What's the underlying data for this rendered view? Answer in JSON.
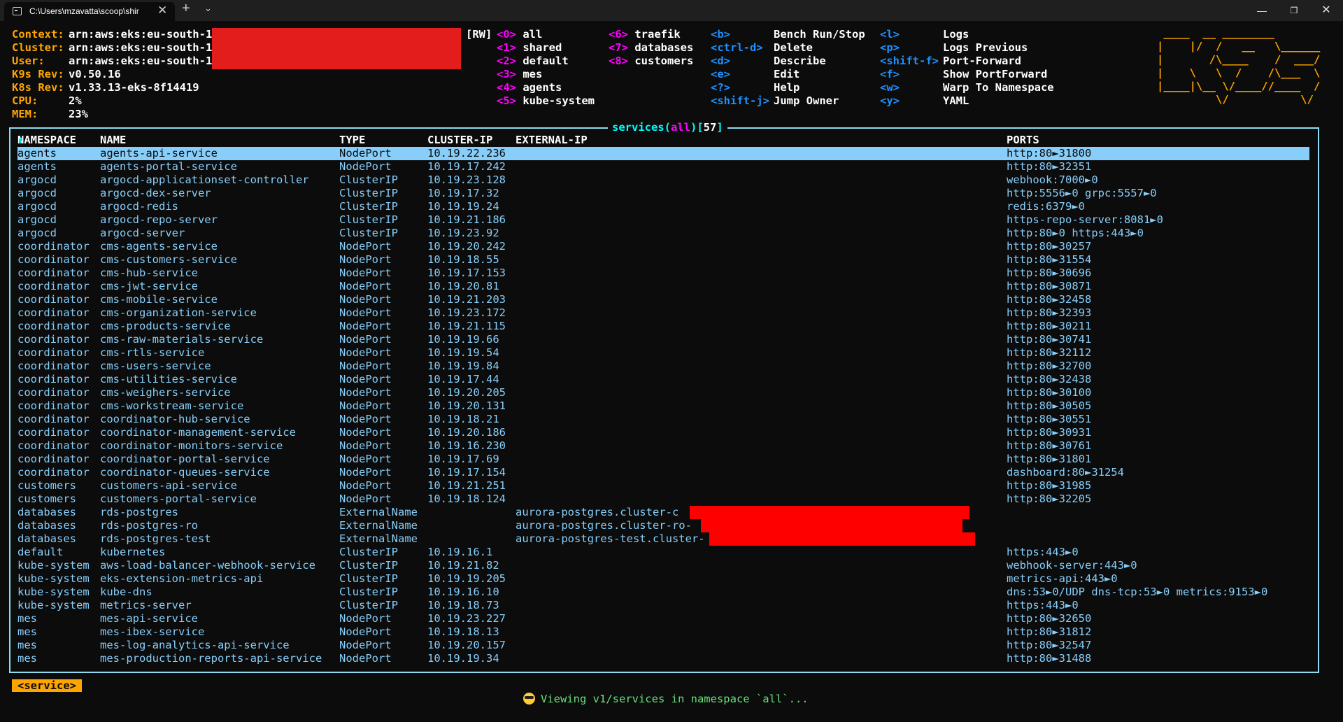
{
  "window": {
    "tab_title": "C:\\Users\\mzavatta\\scoop\\shir",
    "close_glyph": "✕",
    "new_tab_glyph": "+",
    "dropdown_glyph": "⌄",
    "minimize_glyph": "—",
    "maximize_glyph": "❐",
    "window_close_glyph": "✕"
  },
  "header": {
    "context_label": "Context:",
    "context_value": "arn:aws:eks:eu-south-1:",
    "cluster_label": "Cluster:",
    "cluster_value": "arn:aws:eks:eu-south-1:",
    "user_label": "User:",
    "user_value": "arn:aws:eks:eu-south-1:",
    "k9s_rev_label": "K9s Rev:",
    "k9s_rev_value": "v0.50.16",
    "k8s_rev_label": "K8s Rev:",
    "k8s_rev_value": "v1.33.13-eks-8f14419",
    "cpu_label": "CPU:",
    "cpu_value": "2%",
    "mem_label": "MEM:",
    "mem_value": "23%"
  },
  "namespaces": {
    "mode": "[RW]",
    "col1": [
      {
        "key": "<0>",
        "name": "all"
      },
      {
        "key": "<1>",
        "name": "shared"
      },
      {
        "key": "<2>",
        "name": "default"
      },
      {
        "key": "<3>",
        "name": "mes"
      },
      {
        "key": "<4>",
        "name": "agents"
      },
      {
        "key": "<5>",
        "name": "kube-system"
      }
    ],
    "col2": [
      {
        "key": "<6>",
        "name": "traefik"
      },
      {
        "key": "<7>",
        "name": "databases"
      },
      {
        "key": "<8>",
        "name": "customers"
      }
    ]
  },
  "shortcuts": {
    "col1": [
      {
        "key": "<b>",
        "desc": "Bench Run/Stop"
      },
      {
        "key": "<ctrl-d>",
        "desc": "Delete"
      },
      {
        "key": "<d>",
        "desc": "Describe"
      },
      {
        "key": "<e>",
        "desc": "Edit"
      },
      {
        "key": "<?>",
        "desc": "Help"
      },
      {
        "key": "<shift-j>",
        "desc": "Jump Owner"
      }
    ],
    "col2": [
      {
        "key": "<l>",
        "desc": "Logs"
      },
      {
        "key": "<p>",
        "desc": "Logs Previous"
      },
      {
        "key": "<shift-f>",
        "desc": "Port-Forward"
      },
      {
        "key": "<f>",
        "desc": "Show PortForward"
      },
      {
        "key": "<w>",
        "desc": "Warp To Namespace"
      },
      {
        "key": "<y>",
        "desc": "YAML"
      }
    ]
  },
  "logo_art": " ____  __ ________       \n|    |/  /   __   \\______\n|       /\\____    /  ___/\n|    \\   \\  /    /\\___  \\\n|____|\\__ \\/____//____  /\n         \\/           \\/ ",
  "table": {
    "title_resource": "services",
    "title_ns": "all",
    "title_count": "57",
    "headers": {
      "namespace": "NAMESPACE",
      "sort_arrow": "↑",
      "name": "NAME",
      "type": "TYPE",
      "cluster_ip": "CLUSTER-IP",
      "external_ip": "EXTERNAL-IP",
      "ports": "PORTS"
    },
    "rows": [
      {
        "ns": "agents",
        "name": "agents-api-service",
        "type": "NodePort",
        "ip": "10.19.22.236",
        "ext": "",
        "ports": "http:80►31800"
      },
      {
        "ns": "agents",
        "name": "agents-portal-service",
        "type": "NodePort",
        "ip": "10.19.17.242",
        "ext": "",
        "ports": "http:80►32351"
      },
      {
        "ns": "argocd",
        "name": "argocd-applicationset-controller",
        "type": "ClusterIP",
        "ip": "10.19.23.128",
        "ext": "",
        "ports": "webhook:7000►0"
      },
      {
        "ns": "argocd",
        "name": "argocd-dex-server",
        "type": "ClusterIP",
        "ip": "10.19.17.32",
        "ext": "",
        "ports": "http:5556►0 grpc:5557►0"
      },
      {
        "ns": "argocd",
        "name": "argocd-redis",
        "type": "ClusterIP",
        "ip": "10.19.19.24",
        "ext": "",
        "ports": "redis:6379►0"
      },
      {
        "ns": "argocd",
        "name": "argocd-repo-server",
        "type": "ClusterIP",
        "ip": "10.19.21.186",
        "ext": "",
        "ports": "https-repo-server:8081►0"
      },
      {
        "ns": "argocd",
        "name": "argocd-server",
        "type": "ClusterIP",
        "ip": "10.19.23.92",
        "ext": "",
        "ports": "http:80►0 https:443►0"
      },
      {
        "ns": "coordinator",
        "name": "cms-agents-service",
        "type": "NodePort",
        "ip": "10.19.20.242",
        "ext": "",
        "ports": "http:80►30257"
      },
      {
        "ns": "coordinator",
        "name": "cms-customers-service",
        "type": "NodePort",
        "ip": "10.19.18.55",
        "ext": "",
        "ports": "http:80►31554"
      },
      {
        "ns": "coordinator",
        "name": "cms-hub-service",
        "type": "NodePort",
        "ip": "10.19.17.153",
        "ext": "",
        "ports": "http:80►30696"
      },
      {
        "ns": "coordinator",
        "name": "cms-jwt-service",
        "type": "NodePort",
        "ip": "10.19.20.81",
        "ext": "",
        "ports": "http:80►30871"
      },
      {
        "ns": "coordinator",
        "name": "cms-mobile-service",
        "type": "NodePort",
        "ip": "10.19.21.203",
        "ext": "",
        "ports": "http:80►32458"
      },
      {
        "ns": "coordinator",
        "name": "cms-organization-service",
        "type": "NodePort",
        "ip": "10.19.23.172",
        "ext": "",
        "ports": "http:80►32393"
      },
      {
        "ns": "coordinator",
        "name": "cms-products-service",
        "type": "NodePort",
        "ip": "10.19.21.115",
        "ext": "",
        "ports": "http:80►30211"
      },
      {
        "ns": "coordinator",
        "name": "cms-raw-materials-service",
        "type": "NodePort",
        "ip": "10.19.19.66",
        "ext": "",
        "ports": "http:80►30741"
      },
      {
        "ns": "coordinator",
        "name": "cms-rtls-service",
        "type": "NodePort",
        "ip": "10.19.19.54",
        "ext": "",
        "ports": "http:80►32112"
      },
      {
        "ns": "coordinator",
        "name": "cms-users-service",
        "type": "NodePort",
        "ip": "10.19.19.84",
        "ext": "",
        "ports": "http:80►32700"
      },
      {
        "ns": "coordinator",
        "name": "cms-utilities-service",
        "type": "NodePort",
        "ip": "10.19.17.44",
        "ext": "",
        "ports": "http:80►32438"
      },
      {
        "ns": "coordinator",
        "name": "cms-weighers-service",
        "type": "NodePort",
        "ip": "10.19.20.205",
        "ext": "",
        "ports": "http:80►30100"
      },
      {
        "ns": "coordinator",
        "name": "cms-workstream-service",
        "type": "NodePort",
        "ip": "10.19.20.131",
        "ext": "",
        "ports": "http:80►30505"
      },
      {
        "ns": "coordinator",
        "name": "coordinator-hub-service",
        "type": "NodePort",
        "ip": "10.19.18.21",
        "ext": "",
        "ports": "http:80►30551"
      },
      {
        "ns": "coordinator",
        "name": "coordinator-management-service",
        "type": "NodePort",
        "ip": "10.19.20.186",
        "ext": "",
        "ports": "http:80►30931"
      },
      {
        "ns": "coordinator",
        "name": "coordinator-monitors-service",
        "type": "NodePort",
        "ip": "10.19.16.230",
        "ext": "",
        "ports": "http:80►30761"
      },
      {
        "ns": "coordinator",
        "name": "coordinator-portal-service",
        "type": "NodePort",
        "ip": "10.19.17.69",
        "ext": "",
        "ports": "http:80►31801"
      },
      {
        "ns": "coordinator",
        "name": "coordinator-queues-service",
        "type": "NodePort",
        "ip": "10.19.17.154",
        "ext": "",
        "ports": "dashboard:80►31254"
      },
      {
        "ns": "customers",
        "name": "customers-api-service",
        "type": "NodePort",
        "ip": "10.19.21.251",
        "ext": "",
        "ports": "http:80►31985"
      },
      {
        "ns": "customers",
        "name": "customers-portal-service",
        "type": "NodePort",
        "ip": "10.19.18.124",
        "ext": "",
        "ports": "http:80►32205"
      },
      {
        "ns": "databases",
        "name": "rds-postgres",
        "type": "ExternalName",
        "ip": "",
        "ext": "aurora-postgres.cluster-c",
        "ports": ""
      },
      {
        "ns": "databases",
        "name": "rds-postgres-ro",
        "type": "ExternalName",
        "ip": "",
        "ext": "aurora-postgres.cluster-ro-",
        "ports": ""
      },
      {
        "ns": "databases",
        "name": "rds-postgres-test",
        "type": "ExternalName",
        "ip": "",
        "ext": "aurora-postgres-test.cluster-",
        "ports": ""
      },
      {
        "ns": "default",
        "name": "kubernetes",
        "type": "ClusterIP",
        "ip": "10.19.16.1",
        "ext": "",
        "ports": "https:443►0"
      },
      {
        "ns": "kube-system",
        "name": "aws-load-balancer-webhook-service",
        "type": "ClusterIP",
        "ip": "10.19.21.82",
        "ext": "",
        "ports": "webhook-server:443►0"
      },
      {
        "ns": "kube-system",
        "name": "eks-extension-metrics-api",
        "type": "ClusterIP",
        "ip": "10.19.19.205",
        "ext": "",
        "ports": "metrics-api:443►0"
      },
      {
        "ns": "kube-system",
        "name": "kube-dns",
        "type": "ClusterIP",
        "ip": "10.19.16.10",
        "ext": "",
        "ports": "dns:53►0/UDP dns-tcp:53►0 metrics:9153►0"
      },
      {
        "ns": "kube-system",
        "name": "metrics-server",
        "type": "ClusterIP",
        "ip": "10.19.18.73",
        "ext": "",
        "ports": "https:443►0"
      },
      {
        "ns": "mes",
        "name": "mes-api-service",
        "type": "NodePort",
        "ip": "10.19.23.227",
        "ext": "",
        "ports": "http:80►32650"
      },
      {
        "ns": "mes",
        "name": "mes-ibex-service",
        "type": "NodePort",
        "ip": "10.19.18.13",
        "ext": "",
        "ports": "http:80►31812"
      },
      {
        "ns": "mes",
        "name": "mes-log-analytics-api-service",
        "type": "NodePort",
        "ip": "10.19.20.157",
        "ext": "",
        "ports": "http:80►32547"
      },
      {
        "ns": "mes",
        "name": "mes-production-reports-api-service",
        "type": "NodePort",
        "ip": "10.19.19.34",
        "ext": "",
        "ports": "http:80►31488"
      }
    ]
  },
  "crumb": "<service>",
  "status": "Viewing v1/services in namespace `all`..."
}
